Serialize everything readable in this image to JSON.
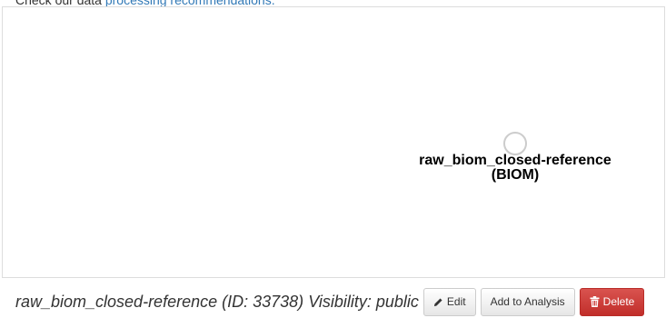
{
  "top_text": {
    "prefix": "Check our data ",
    "link": "processing recommendations."
  },
  "graph": {
    "node": {
      "label_line1": "raw_biom_closed-reference",
      "label_line2": "(BIOM)"
    }
  },
  "footer": {
    "artifact_name": "raw_biom_closed-reference",
    "id_text": "(ID: 33738)",
    "visibility_text": "Visibility: public",
    "edit_label": "Edit",
    "add_to_analysis_label": "Add to Analysis",
    "delete_label": "Delete"
  },
  "colors": {
    "link": "#337ab7",
    "danger": "#d9534f",
    "node_stroke": "#cccccc"
  },
  "icons": {
    "edit": "pencil-icon",
    "delete": "trash-icon"
  }
}
